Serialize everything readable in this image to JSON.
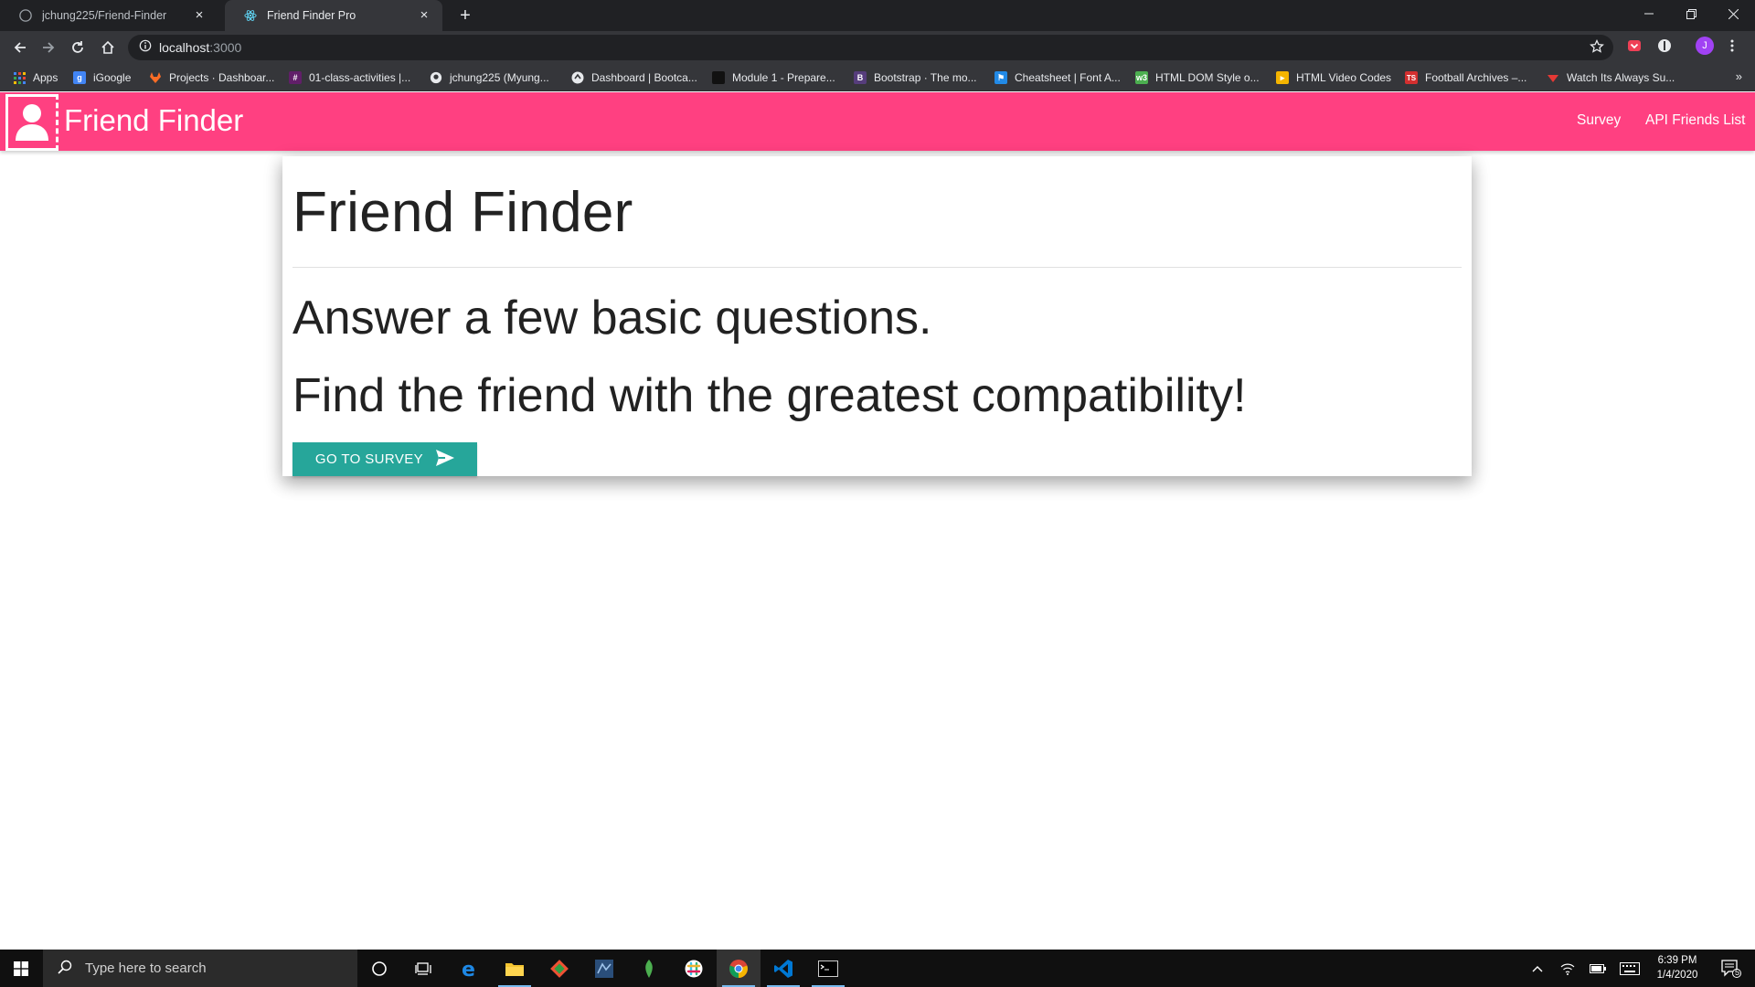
{
  "browser": {
    "tabs": [
      {
        "title": "jchung225/Friend-Finder",
        "active": false
      },
      {
        "title": "Friend Finder Pro",
        "active": true
      }
    ],
    "url_host": "localhost",
    "url_port": ":3000",
    "profile_initial": "J",
    "bookmarks": [
      {
        "label": "Apps",
        "icon": "apps-grid-icon",
        "color": "#e8eaed"
      },
      {
        "label": "iGoogle",
        "icon": "igoogle-icon",
        "color": "#4285f4"
      },
      {
        "label": "Projects · Dashboar...",
        "icon": "gitlab-icon",
        "color": "#fc6d26"
      },
      {
        "label": "01-class-activities |...",
        "icon": "slack-icon",
        "color": "#611f69"
      },
      {
        "label": "jchung225 (Myung...",
        "icon": "github-icon",
        "color": "#ffffff"
      },
      {
        "label": "Dashboard | Bootca...",
        "icon": "bootcamp-icon",
        "color": "#ffffff"
      },
      {
        "label": "Module 1 - Prepare...",
        "icon": "book-icon",
        "color": "#222222"
      },
      {
        "label": "Bootstrap · The mo...",
        "icon": "bootstrap-icon",
        "color": "#563d7c"
      },
      {
        "label": "Cheatsheet | Font A...",
        "icon": "font-awesome-icon",
        "color": "#228ae6"
      },
      {
        "label": "HTML DOM Style o...",
        "icon": "w3schools-icon",
        "color": "#4caf50"
      },
      {
        "label": "HTML Video Codes",
        "icon": "video-codes-icon",
        "color": "#f4b400"
      },
      {
        "label": "Football Archives –...",
        "icon": "ts-icon",
        "color": "#d32f2f"
      },
      {
        "label": "Watch Its Always Su...",
        "icon": "stream-icon",
        "color": "#e53935"
      }
    ]
  },
  "app": {
    "brand": "Friend Finder",
    "nav": [
      {
        "label": "Survey"
      },
      {
        "label": "API Friends List"
      }
    ],
    "colors": {
      "navbar": "#ff4081",
      "button": "#26a69a"
    },
    "card": {
      "heading": "Friend Finder",
      "line1": "Answer a few basic questions.",
      "line2": "Find the friend with the greatest compatibility!",
      "button_label": "GO TO SURVEY"
    }
  },
  "taskbar": {
    "search_placeholder": "Type here to search",
    "time": "6:39 PM",
    "date": "1/4/2020",
    "notification_count": "5"
  }
}
